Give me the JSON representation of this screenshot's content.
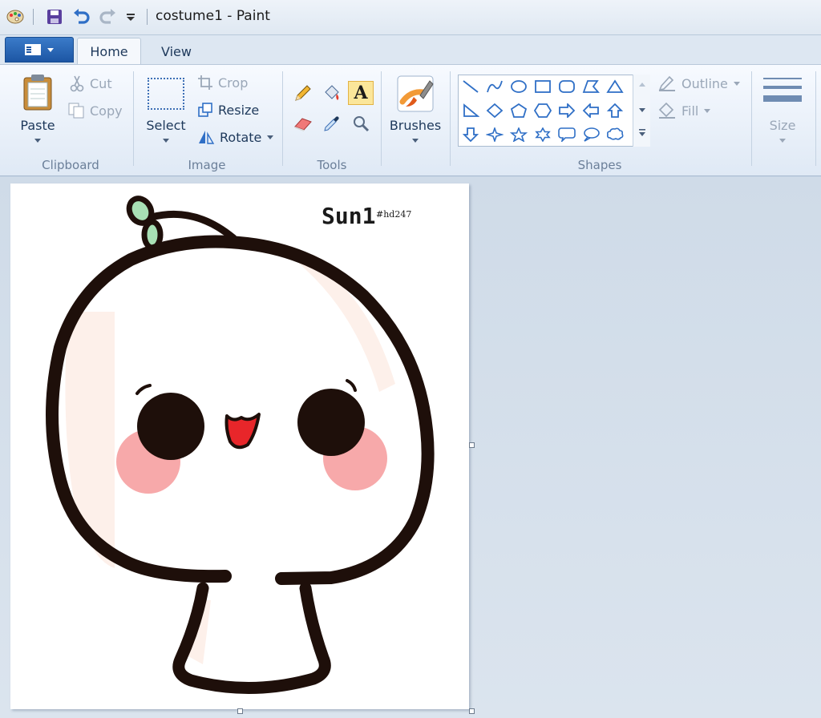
{
  "window": {
    "title": "costume1 - Paint"
  },
  "tabs": {
    "home": "Home",
    "view": "View"
  },
  "clipboard": {
    "label": "Clipboard",
    "paste": "Paste",
    "cut": "Cut",
    "copy": "Copy"
  },
  "image": {
    "label": "Image",
    "select": "Select",
    "crop": "Crop",
    "resize": "Resize",
    "rotate": "Rotate"
  },
  "tools": {
    "label": "Tools",
    "text_glyph": "A"
  },
  "brushes": {
    "label": "Brushes"
  },
  "shapes": {
    "label": "Shapes",
    "outline": "Outline",
    "fill": "Fill"
  },
  "size": {
    "label": "Size"
  },
  "canvas": {
    "signature": "Sun1",
    "tag": "#hd247"
  },
  "colors": {
    "accent": "#1d56a4",
    "ribbon_text": "#1e395b",
    "selected_tool": "#fbe69a",
    "cheek": "#f7a9aa",
    "tongue": "#e8262a",
    "leaf": "#a8e0b4",
    "outline": "#1e0f0a"
  }
}
